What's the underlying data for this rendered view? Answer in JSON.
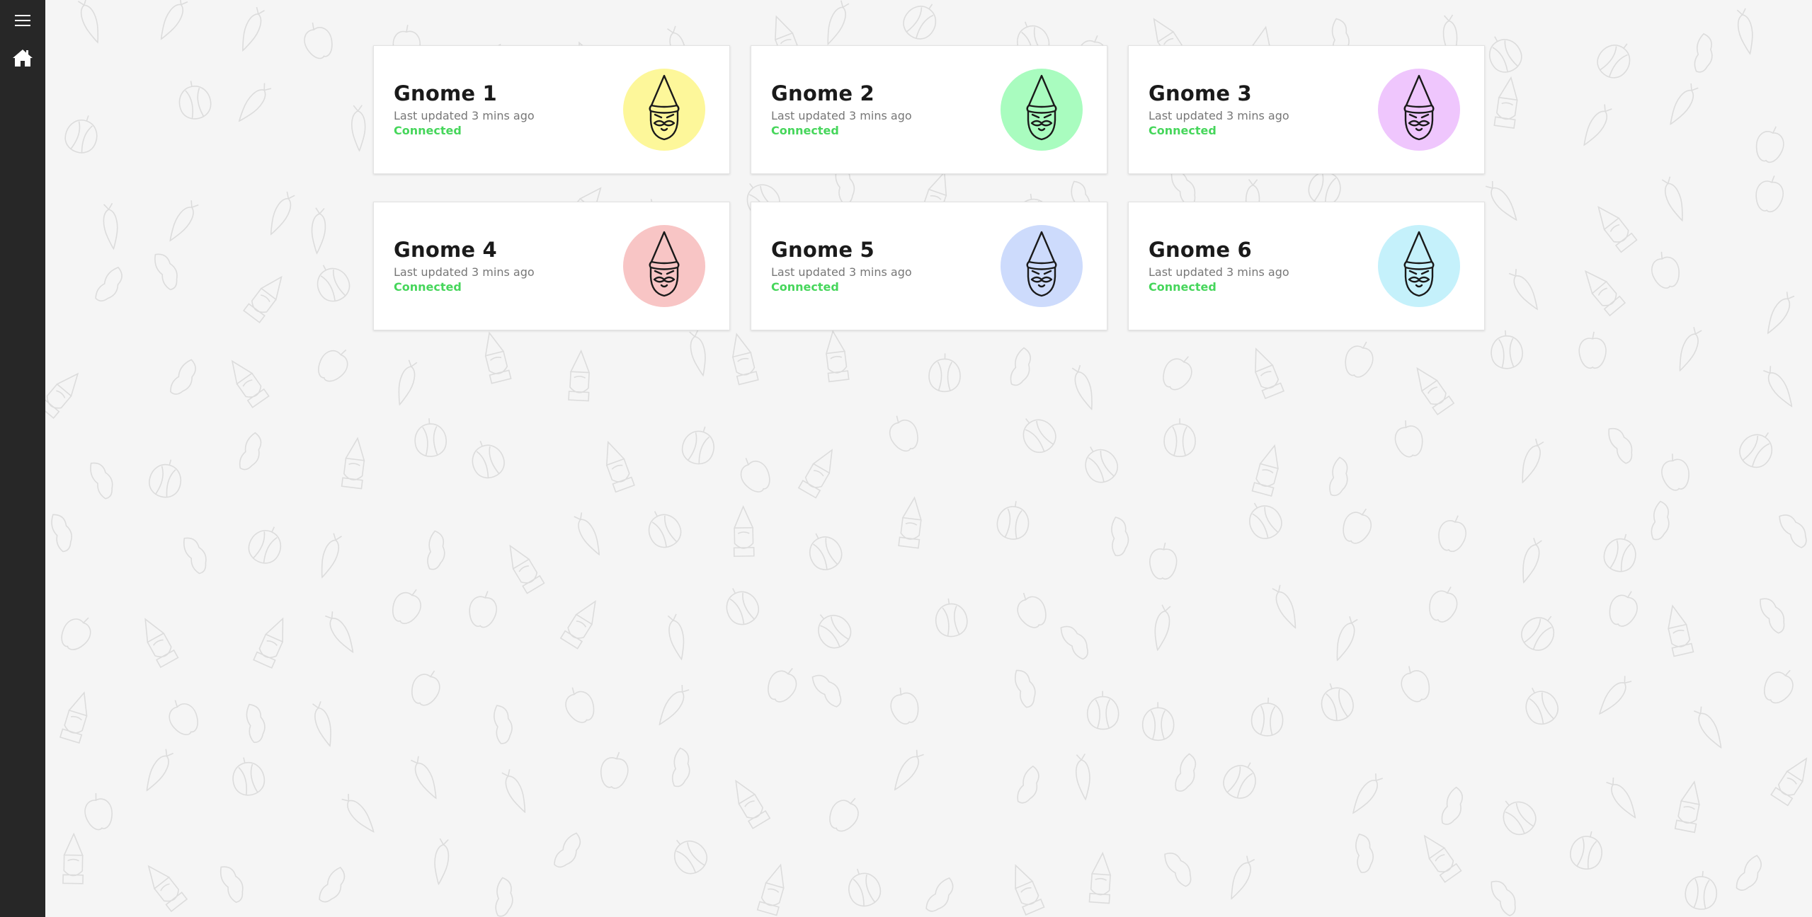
{
  "sidebar": {
    "menu_icon": "hamburger-menu-icon",
    "home_icon": "home-icon"
  },
  "gnomes": [
    {
      "name": "Gnome 1",
      "updated": "Last updated 3 mins ago",
      "status": "Connected",
      "color": "#fdf79a"
    },
    {
      "name": "Gnome 2",
      "updated": "Last updated 3 mins ago",
      "status": "Connected",
      "color": "#a9fcbf"
    },
    {
      "name": "Gnome 3",
      "updated": "Last updated 3 mins ago",
      "status": "Connected",
      "color": "#efc6fd"
    },
    {
      "name": "Gnome 4",
      "updated": "Last updated 3 mins ago",
      "status": "Connected",
      "color": "#f8c5c5"
    },
    {
      "name": "Gnome 5",
      "updated": "Last updated 3 mins ago",
      "status": "Connected",
      "color": "#cddbfc"
    },
    {
      "name": "Gnome 6",
      "updated": "Last updated 3 mins ago",
      "status": "Connected",
      "color": "#c5f1fb"
    }
  ],
  "colors": {
    "sidebar_bg": "#272727",
    "page_bg": "#f5f5f5",
    "status_green": "#46d65b"
  }
}
